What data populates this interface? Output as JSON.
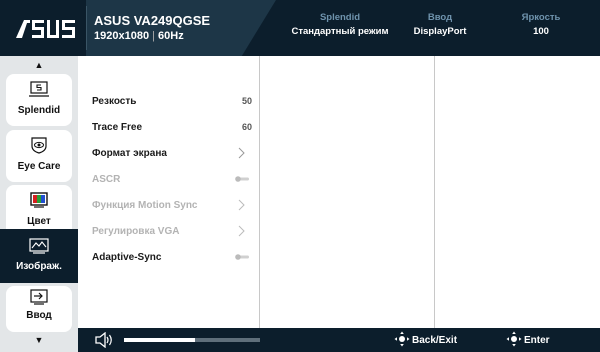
{
  "header": {
    "logo_text": "/ISUS",
    "model": "ASUS VA249QGSE",
    "resolution": "1920x1080",
    "refresh": "60Hz",
    "status": [
      {
        "label": "Splendid",
        "value": "Стандартный режим"
      },
      {
        "label": "Ввод",
        "value": "DisplayPort"
      },
      {
        "label": "Яркость",
        "value": "100"
      }
    ]
  },
  "sidebar": {
    "items": [
      {
        "label": "Splendid",
        "icon": "splendid-icon",
        "active": false
      },
      {
        "label": "Eye Care",
        "icon": "eye-care-icon",
        "active": false
      },
      {
        "label": "Цвет",
        "icon": "color-icon",
        "active": false
      },
      {
        "label": "Изображ.",
        "icon": "image-icon",
        "active": true
      },
      {
        "label": "Ввод",
        "icon": "input-icon",
        "active": false
      }
    ]
  },
  "menu": {
    "items": [
      {
        "label": "Резкость",
        "value": "50",
        "type": "value",
        "enabled": true
      },
      {
        "label": "Trace Free",
        "value": "60",
        "type": "value",
        "enabled": true
      },
      {
        "label": "Формат экрана",
        "type": "submenu",
        "enabled": true
      },
      {
        "label": "ASCR",
        "type": "toggle",
        "enabled": false
      },
      {
        "label": "Функция Motion Sync",
        "type": "submenu",
        "enabled": false
      },
      {
        "label": "Регулировка VGA",
        "type": "submenu",
        "enabled": false
      },
      {
        "label": "Adaptive-Sync",
        "type": "toggle",
        "enabled": true
      }
    ]
  },
  "footer": {
    "volume_level": 0.52,
    "back_label": "Back/Exit",
    "enter_label": "Enter"
  },
  "colors": {
    "header_bg": "#0c1e2c",
    "header_accent": "#6f93ad",
    "sidebar_bg": "#e3e6e8"
  }
}
